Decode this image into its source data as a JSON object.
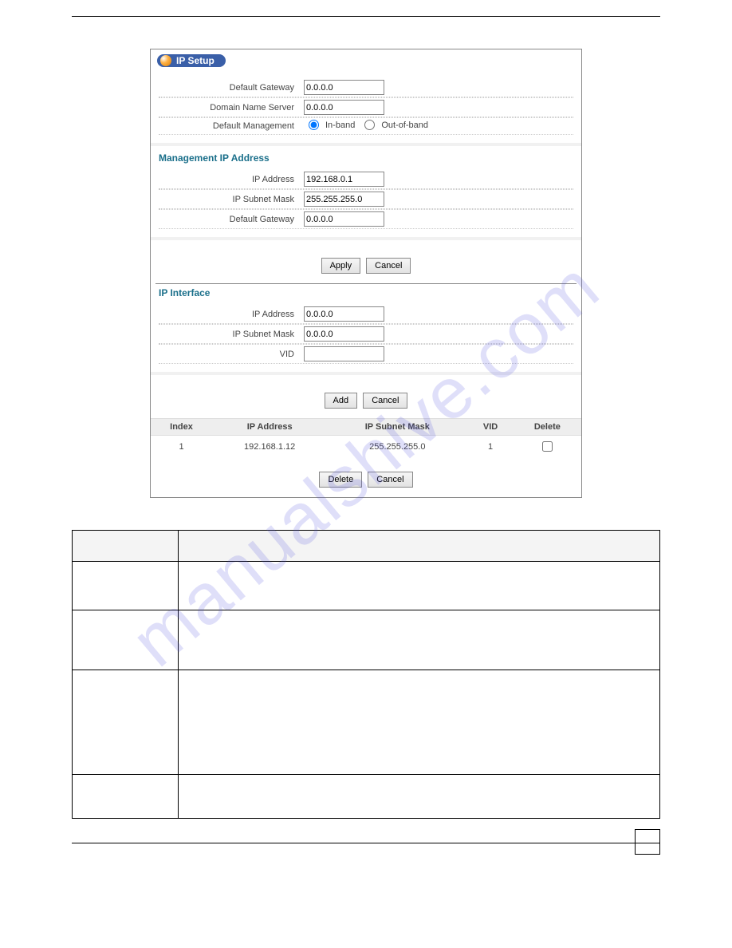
{
  "watermark_text": "manualshive.com",
  "panel": {
    "title": "IP Setup",
    "basic": {
      "default_gateway_label": "Default Gateway",
      "default_gateway_value": "0.0.0.0",
      "dns_label": "Domain Name Server",
      "dns_value": "0.0.0.0",
      "default_mgmt_label": "Default Management",
      "inband_label": "In-band",
      "outofband_label": "Out-of-band",
      "mgmt_selected": "inband"
    },
    "mgmt_ip": {
      "section_title": "Management IP Address",
      "ip_label": "IP Address",
      "ip_value": "192.168.0.1",
      "mask_label": "IP Subnet Mask",
      "mask_value": "255.255.255.0",
      "gateway_label": "Default Gateway",
      "gateway_value": "0.0.0.0",
      "apply_btn": "Apply",
      "cancel_btn": "Cancel"
    },
    "ip_interface": {
      "section_title": "IP Interface",
      "ip_label": "IP Address",
      "ip_value": "0.0.0.0",
      "mask_label": "IP Subnet Mask",
      "mask_value": "0.0.0.0",
      "vid_label": "VID",
      "vid_value": "",
      "add_btn": "Add",
      "cancel_btn": "Cancel"
    },
    "table": {
      "headers": {
        "index": "Index",
        "ip": "IP Address",
        "mask": "IP Subnet Mask",
        "vid": "VID",
        "delete": "Delete"
      },
      "rows": [
        {
          "index": "1",
          "ip": "192.168.1.12",
          "mask": "255.255.255.0",
          "vid": "1",
          "checked": false
        }
      ],
      "delete_btn": "Delete",
      "cancel_btn": "Cancel"
    }
  }
}
